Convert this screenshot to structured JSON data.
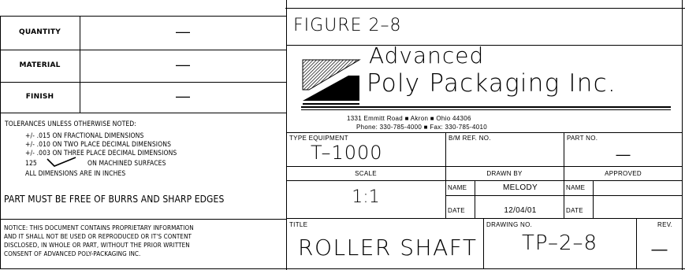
{
  "left_table": {
    "rows": [
      {
        "label": "QUANTITY",
        "value": "—"
      },
      {
        "label": "MATERIAL",
        "value": "—"
      },
      {
        "label": "FINISH",
        "value": "—"
      }
    ]
  },
  "tolerances": {
    "heading": "TOLERANCES UNLESS OTHERWISE NOTED:",
    "line1": "+/- .015 ON FRACTIONAL DIMENSIONS",
    "line2": "+/- .010 ON TWO PLACE DECIMAL DIMENSIONS",
    "line3": "+/- .003 ON THREE PLACE DECIMAL DIMENSIONS",
    "finish_value": "125",
    "finish_text": "ON MACHINED SURFACES",
    "units": "ALL DIMENSIONS ARE IN INCHES",
    "burrs": "PART MUST BE FREE OF BURRS AND SHARP EDGES"
  },
  "notice": {
    "line1": "NOTICE: THIS DOCUMENT CONTAINS PROPRIETARY INFORMATION",
    "line2": "AND IT SHALL NOT BE USED OR REPRODUCED OR IT'S CONTENT",
    "line3": "DISCLOSED, IN WHOLE OR PART, WITHOUT THE PRIOR WRITTEN",
    "line4": "CONSENT OF ADVANCED POLY-PACKAGING INC."
  },
  "figure_label": "FIGURE 2–8",
  "company": {
    "name_line1": "Advanced",
    "name_line2": "Poly Packaging Inc.",
    "address": "1331 Emmitt Road  ■  Akron  ■  Ohio 44306",
    "phone": "Phone: 330-785-4000  ■  Fax: 330-785-4010"
  },
  "info": {
    "type_equipment_label": "TYPE EQUIPMENT",
    "type_equipment_value": "T–1000",
    "bm_ref_label": "B/M REF. NO.",
    "part_no_label": "PART NO.",
    "part_no_value": "—",
    "scale_label": "SCALE",
    "scale_value": "1:1",
    "drawn_by_label": "DRAWN BY",
    "approved_label": "APPROVED",
    "name_label": "NAME",
    "drawn_name": "MELODY",
    "date_label": "DATE",
    "drawn_date": "12/04/01",
    "approved_name_label": "NAME",
    "approved_date_label": "DATE"
  },
  "title_block": {
    "title_label": "TITLE",
    "title_value": "ROLLER SHAFT",
    "drawing_no_label": "DRAWING NO.",
    "drawing_no_value": "TP–2–8",
    "rev_label": "REV.",
    "rev_value": "—"
  }
}
